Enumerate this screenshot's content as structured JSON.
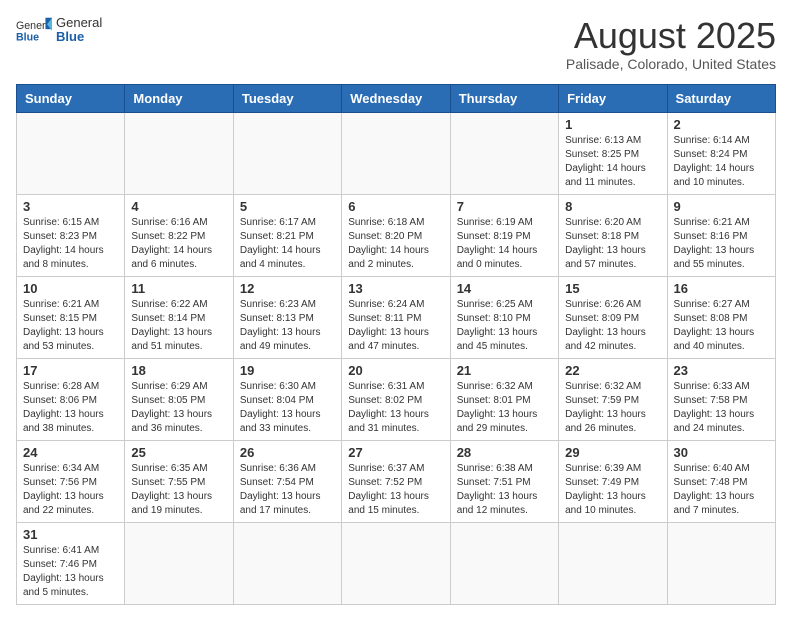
{
  "header": {
    "logo_general": "General",
    "logo_blue": "Blue",
    "month_year": "August 2025",
    "location": "Palisade, Colorado, United States"
  },
  "days": [
    "Sunday",
    "Monday",
    "Tuesday",
    "Wednesday",
    "Thursday",
    "Friday",
    "Saturday"
  ],
  "weeks": [
    [
      {
        "date": "",
        "info": ""
      },
      {
        "date": "",
        "info": ""
      },
      {
        "date": "",
        "info": ""
      },
      {
        "date": "",
        "info": ""
      },
      {
        "date": "",
        "info": ""
      },
      {
        "date": "1",
        "info": "Sunrise: 6:13 AM\nSunset: 8:25 PM\nDaylight: 14 hours and 11 minutes."
      },
      {
        "date": "2",
        "info": "Sunrise: 6:14 AM\nSunset: 8:24 PM\nDaylight: 14 hours and 10 minutes."
      }
    ],
    [
      {
        "date": "3",
        "info": "Sunrise: 6:15 AM\nSunset: 8:23 PM\nDaylight: 14 hours and 8 minutes."
      },
      {
        "date": "4",
        "info": "Sunrise: 6:16 AM\nSunset: 8:22 PM\nDaylight: 14 hours and 6 minutes."
      },
      {
        "date": "5",
        "info": "Sunrise: 6:17 AM\nSunset: 8:21 PM\nDaylight: 14 hours and 4 minutes."
      },
      {
        "date": "6",
        "info": "Sunrise: 6:18 AM\nSunset: 8:20 PM\nDaylight: 14 hours and 2 minutes."
      },
      {
        "date": "7",
        "info": "Sunrise: 6:19 AM\nSunset: 8:19 PM\nDaylight: 14 hours and 0 minutes."
      },
      {
        "date": "8",
        "info": "Sunrise: 6:20 AM\nSunset: 8:18 PM\nDaylight: 13 hours and 57 minutes."
      },
      {
        "date": "9",
        "info": "Sunrise: 6:21 AM\nSunset: 8:16 PM\nDaylight: 13 hours and 55 minutes."
      }
    ],
    [
      {
        "date": "10",
        "info": "Sunrise: 6:21 AM\nSunset: 8:15 PM\nDaylight: 13 hours and 53 minutes."
      },
      {
        "date": "11",
        "info": "Sunrise: 6:22 AM\nSunset: 8:14 PM\nDaylight: 13 hours and 51 minutes."
      },
      {
        "date": "12",
        "info": "Sunrise: 6:23 AM\nSunset: 8:13 PM\nDaylight: 13 hours and 49 minutes."
      },
      {
        "date": "13",
        "info": "Sunrise: 6:24 AM\nSunset: 8:11 PM\nDaylight: 13 hours and 47 minutes."
      },
      {
        "date": "14",
        "info": "Sunrise: 6:25 AM\nSunset: 8:10 PM\nDaylight: 13 hours and 45 minutes."
      },
      {
        "date": "15",
        "info": "Sunrise: 6:26 AM\nSunset: 8:09 PM\nDaylight: 13 hours and 42 minutes."
      },
      {
        "date": "16",
        "info": "Sunrise: 6:27 AM\nSunset: 8:08 PM\nDaylight: 13 hours and 40 minutes."
      }
    ],
    [
      {
        "date": "17",
        "info": "Sunrise: 6:28 AM\nSunset: 8:06 PM\nDaylight: 13 hours and 38 minutes."
      },
      {
        "date": "18",
        "info": "Sunrise: 6:29 AM\nSunset: 8:05 PM\nDaylight: 13 hours and 36 minutes."
      },
      {
        "date": "19",
        "info": "Sunrise: 6:30 AM\nSunset: 8:04 PM\nDaylight: 13 hours and 33 minutes."
      },
      {
        "date": "20",
        "info": "Sunrise: 6:31 AM\nSunset: 8:02 PM\nDaylight: 13 hours and 31 minutes."
      },
      {
        "date": "21",
        "info": "Sunrise: 6:32 AM\nSunset: 8:01 PM\nDaylight: 13 hours and 29 minutes."
      },
      {
        "date": "22",
        "info": "Sunrise: 6:32 AM\nSunset: 7:59 PM\nDaylight: 13 hours and 26 minutes."
      },
      {
        "date": "23",
        "info": "Sunrise: 6:33 AM\nSunset: 7:58 PM\nDaylight: 13 hours and 24 minutes."
      }
    ],
    [
      {
        "date": "24",
        "info": "Sunrise: 6:34 AM\nSunset: 7:56 PM\nDaylight: 13 hours and 22 minutes."
      },
      {
        "date": "25",
        "info": "Sunrise: 6:35 AM\nSunset: 7:55 PM\nDaylight: 13 hours and 19 minutes."
      },
      {
        "date": "26",
        "info": "Sunrise: 6:36 AM\nSunset: 7:54 PM\nDaylight: 13 hours and 17 minutes."
      },
      {
        "date": "27",
        "info": "Sunrise: 6:37 AM\nSunset: 7:52 PM\nDaylight: 13 hours and 15 minutes."
      },
      {
        "date": "28",
        "info": "Sunrise: 6:38 AM\nSunset: 7:51 PM\nDaylight: 13 hours and 12 minutes."
      },
      {
        "date": "29",
        "info": "Sunrise: 6:39 AM\nSunset: 7:49 PM\nDaylight: 13 hours and 10 minutes."
      },
      {
        "date": "30",
        "info": "Sunrise: 6:40 AM\nSunset: 7:48 PM\nDaylight: 13 hours and 7 minutes."
      }
    ],
    [
      {
        "date": "31",
        "info": "Sunrise: 6:41 AM\nSunset: 7:46 PM\nDaylight: 13 hours and 5 minutes."
      },
      {
        "date": "",
        "info": ""
      },
      {
        "date": "",
        "info": ""
      },
      {
        "date": "",
        "info": ""
      },
      {
        "date": "",
        "info": ""
      },
      {
        "date": "",
        "info": ""
      },
      {
        "date": "",
        "info": ""
      }
    ]
  ]
}
